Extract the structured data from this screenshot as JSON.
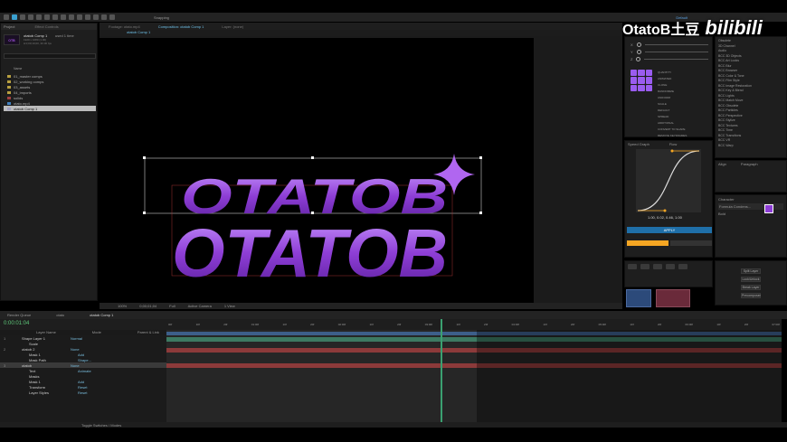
{
  "watermark": {
    "text": "OtatoB土豆",
    "brand": "bilibili"
  },
  "menu": {
    "workspace": "Default",
    "search": "Snapping"
  },
  "project": {
    "title": "Project",
    "effect_tab": "Effect Controls",
    "comp_name": "otatob Comp 1",
    "used": "used 1 time",
    "meta1": "1920 x 1080 (1.00)",
    "meta2": "Δ 0;00;10;00, 30.00 fps",
    "col_name": "Name",
    "items": [
      "01_master comps",
      "02_working comps",
      "03_assets",
      "04_imports",
      "solids",
      "otato.mp4",
      "otatob Comp 1"
    ]
  },
  "viewer": {
    "tabs": [
      "Footage: otato.mp4",
      "Composition: otatob Comp 1",
      "Layer: (none)"
    ],
    "crumb": "otatob Comp 1",
    "zoom": "100%",
    "time": "0;00;01;04",
    "res": "Full",
    "camera": "Active Camera",
    "views": "1 View",
    "logo_text": "OTATOB"
  },
  "timeline": {
    "tabs": [
      "Render Queue",
      "otato",
      "otatob Comp 1"
    ],
    "time": "0:00:01:04",
    "cols": [
      "Layer Name",
      "Mode",
      "Parent & Link"
    ],
    "layers": [
      {
        "num": "1",
        "name": "Shape Layer 1",
        "mode": "Normal"
      },
      {
        "num": "",
        "name": "Scale",
        "mode": ""
      },
      {
        "num": "2",
        "name": "otatob 2",
        "mode": "None"
      },
      {
        "num": "",
        "name": "Mask 1",
        "mode": "Add"
      },
      {
        "num": "",
        "name": "Mask Path",
        "mode": "Shape..."
      },
      {
        "num": "3",
        "name": "otatob",
        "mode": "None"
      },
      {
        "num": "",
        "name": "Text",
        "mode": "Animate"
      },
      {
        "num": "",
        "name": "Masks",
        "mode": ""
      },
      {
        "num": "",
        "name": "Mask 1",
        "mode": "Add"
      },
      {
        "num": "",
        "name": "Transform",
        "mode": "Reset"
      },
      {
        "num": "",
        "name": "Layer Styles",
        "mode": "Reset"
      }
    ],
    "ruler": [
      "00f",
      "10f",
      "20f",
      "01:00f",
      "10f",
      "20f",
      "02:00f",
      "10f",
      "20f",
      "03:00f",
      "10f",
      "20f",
      "04:00f",
      "10f",
      "20f",
      "05:00f",
      "10f",
      "20f",
      "06:00f",
      "10f",
      "20f",
      "07:00f"
    ],
    "footer": "Toggle Switches / Modes"
  },
  "effects": {
    "sliders": [
      "X",
      "Y",
      "Z"
    ],
    "labels": [
      "QUANTITY",
      "ANIMATED",
      "CLONE",
      "RANDOMIZE",
      "UNIFORM",
      "SCALE",
      "DEFAULT",
      "SPREAD",
      "ADDITIONAL",
      "CONVERT TO SHAPE",
      "REMOVE KEYFRAMES"
    ]
  },
  "graph": {
    "title": "Speed Graph",
    "mode": "Flow",
    "values": "1.00, 0.02, 0.46, 1.00",
    "apply": "APPLY"
  },
  "fx_list": {
    "items": [
      "Obsolete",
      "3D Channel",
      "Audio",
      "BCC 3D Objects",
      "BCC Art Looks",
      "BCC Blur",
      "BCC Browser",
      "BCC Color & Tone",
      "BCC Film Style",
      "BCC Image Restoration",
      "BCC Key & Blend",
      "BCC Lights",
      "BCC Match Move",
      "BCC Obsolete",
      "BCC Particles",
      "BCC Perspective",
      "BCC Stylize",
      "BCC Textures",
      "BCC Time",
      "BCC Transitions",
      "BCC VR",
      "BCC Warp"
    ]
  },
  "align": {
    "title": "Align",
    "target": "Paragraph"
  },
  "character": {
    "title": "Character",
    "font": "Formula Condens...",
    "style": "Bold"
  },
  "right_buttons": [
    "Split Layer",
    "Lock/Unlock",
    "Break Layer",
    "Precomposer"
  ],
  "colors": {
    "accent": "#f5a623",
    "purple": "#8e3ed6",
    "track_green": "#3d7a62",
    "track_red": "#8c3a3a",
    "cyan": "#3aa0d0"
  }
}
